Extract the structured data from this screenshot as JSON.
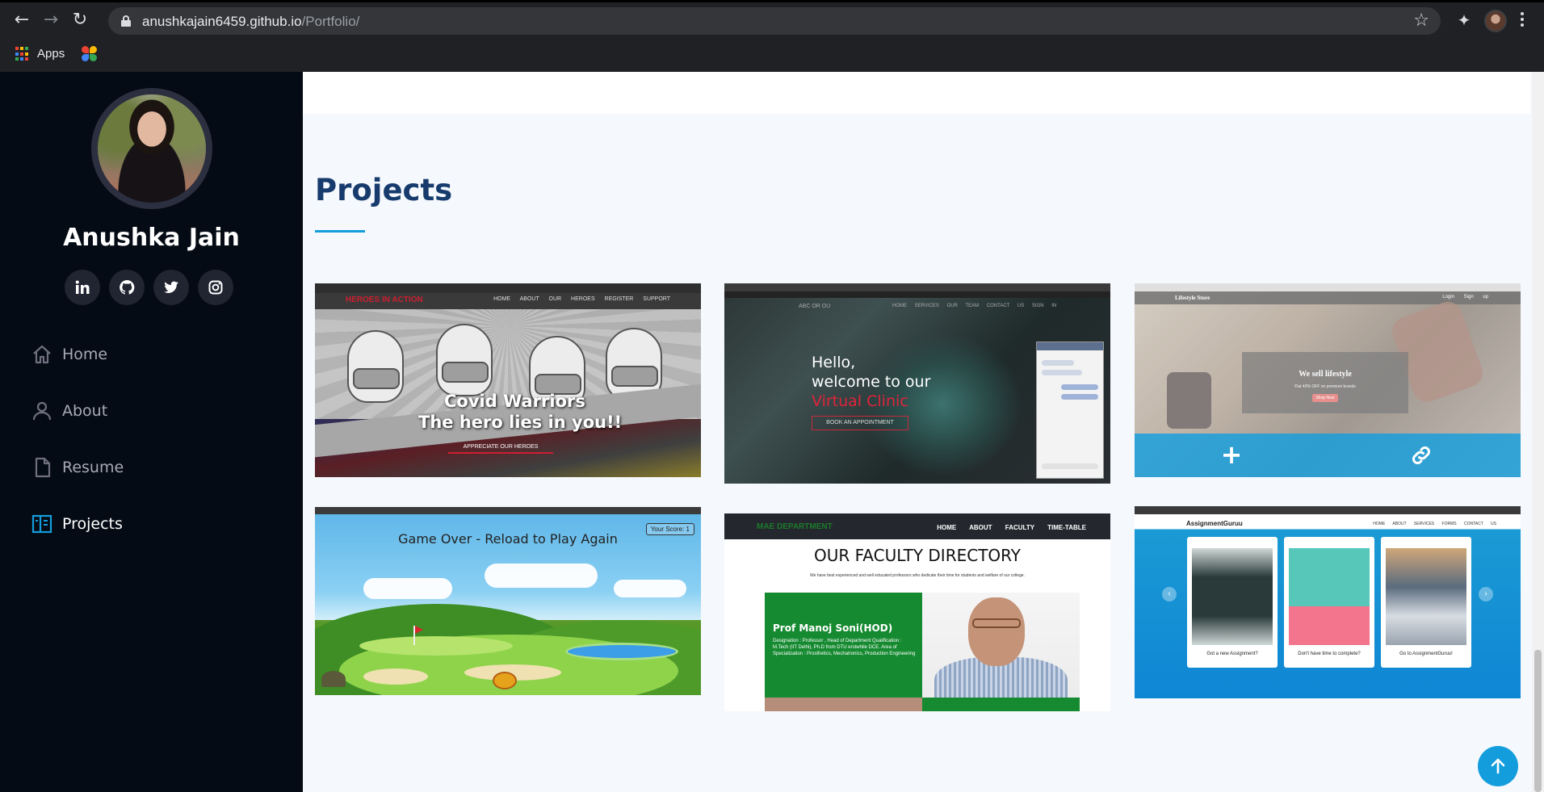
{
  "browser": {
    "url_host": "anushkajain6459.github.io",
    "url_path": "/Portfolio/",
    "bookmarks": [
      {
        "label": "Apps"
      }
    ]
  },
  "sidebar": {
    "name": "Anushka Jain",
    "socials": [
      "linkedin-icon",
      "github-icon",
      "twitter-icon",
      "instagram-icon"
    ],
    "nav": [
      {
        "label": "Home",
        "icon": "home-icon",
        "active": false
      },
      {
        "label": "About",
        "icon": "user-icon",
        "active": false
      },
      {
        "label": "Resume",
        "icon": "file-icon",
        "active": false
      },
      {
        "label": "Projects",
        "icon": "book-icon",
        "active": true
      }
    ]
  },
  "main": {
    "section_title": "Projects",
    "projects": [
      {
        "id": "covid",
        "brand": "HEROES IN ACTION",
        "links": "HOME ABOUT OUR HEROES REGISTER SUPPORT",
        "line1": "Covid Warriors",
        "line2": "The hero lies in you!!",
        "button": "APPRECIATE OUR HEROES"
      },
      {
        "id": "clinic",
        "logo": "ABC  OR  OU",
        "links": "HOME SERVICES OUR TEAM CONTACT US SIGN IN",
        "hello1": "Hello,",
        "hello2": "welcome to our",
        "hello3": "Virtual Clinic",
        "button": "BOOK AN APPOINTMENT"
      },
      {
        "id": "lifestyle",
        "brand": "Lifestyle Store",
        "links": "Login  Sign up",
        "headline": "We sell lifestyle",
        "subline": "Flat 40% OFF on premium brands",
        "button": "Shop Now",
        "overlay_plus": "+"
      },
      {
        "id": "golf",
        "title": "Game Over - Reload to Play Again",
        "score": "Your Score: 1"
      },
      {
        "id": "faculty",
        "brand": "MAE DEPARTMENT",
        "links": "HOME ABOUT FACULTY TIME-TABLE",
        "title": "OUR FACULTY DIRECTORY",
        "desc": "We have best experienced and well educated professors who dedicate their time for students and welfare of our college.",
        "prof_name": "Prof Manoj Soni(HOD)",
        "prof_details": "Designation : Professor , Head of Department Qualification : M.Tech (IIT Delhi), Ph.D from DTU erstwhile DCE. Area of Specialization : Prosthetics, Mechatronics, Production Engineering"
      },
      {
        "id": "assignment",
        "brand": "AssignmentGuruu",
        "links": "HOME ABOUT SERVICES FORMS CONTACT US",
        "captions": [
          "Got a new Assignment?",
          "Don't have time to complete?",
          "Go to AssignmentGuruu!"
        ],
        "arrow_prev": "‹",
        "arrow_next": "›"
      }
    ]
  },
  "colors": {
    "accent": "#149ddd",
    "sidebar_bg": "#040b14",
    "title": "#173b6c"
  }
}
